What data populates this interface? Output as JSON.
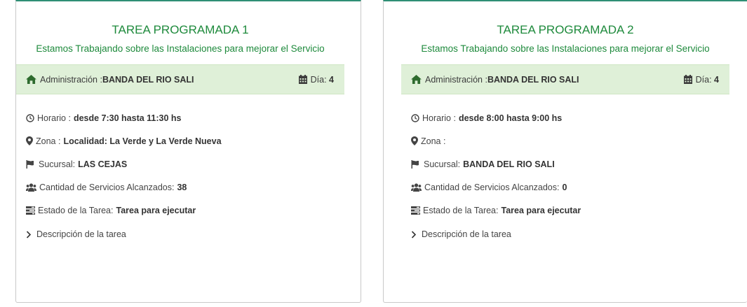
{
  "cards": [
    {
      "title": "TAREA PROGRAMADA 1",
      "subtitle": "Estamos Trabajando sobre las Instalaciones para mejorar el Servicio",
      "admin_label": "Administración :",
      "admin_value": "BANDA DEL RIO SALI",
      "dia_label": "Día:",
      "dia_value": "4",
      "horario_label": "Horario :",
      "horario_value": "desde 7:30 hasta 11:30 hs",
      "zona_label": "Zona :",
      "zona_value": "Localidad: La Verde y La Verde Nueva",
      "sucursal_label": "Sucursal:",
      "sucursal_value": "LAS CEJAS",
      "cantidad_label": "Cantidad de Servicios Alcanzados:",
      "cantidad_value": "38",
      "estado_label": "Estado de la Tarea:",
      "estado_value": "Tarea para ejecutar",
      "descripcion_label": "Descripción de la tarea"
    },
    {
      "title": "TAREA PROGRAMADA 2",
      "subtitle": "Estamos Trabajando sobre las Instalaciones para mejorar el Servicio",
      "admin_label": "Administración :",
      "admin_value": "BANDA DEL RIO SALI",
      "dia_label": "Día:",
      "dia_value": "4",
      "horario_label": "Horario :",
      "horario_value": "desde 8:00 hasta 9:00 hs",
      "zona_label": "Zona :",
      "zona_value": "",
      "sucursal_label": "Sucursal:",
      "sucursal_value": "BANDA DEL RIO SALI",
      "cantidad_label": "Cantidad de Servicios Alcanzados:",
      "cantidad_value": "0",
      "estado_label": "Estado de la Tarea:",
      "estado_value": "Tarea para ejecutar",
      "descripcion_label": "Descripción de la tarea"
    }
  ],
  "icons": {
    "admin": "home-icon",
    "dia": "calendar-icon",
    "horario": "clock-icon",
    "zona": "map-marker-icon",
    "sucursal": "flag-icon",
    "cantidad": "users-icon",
    "estado": "tasks-icon",
    "descripcion": "chevron-right-icon"
  },
  "colors": {
    "title_green": "#1e8a3c",
    "admin_bar_bg": "#dff0d8",
    "card_top_border": "#2f8f75"
  }
}
